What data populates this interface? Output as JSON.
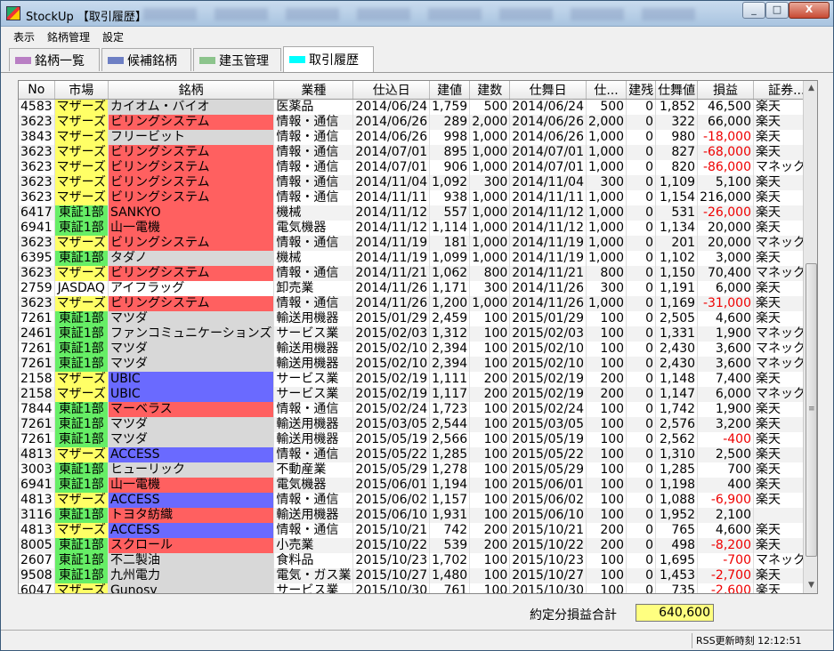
{
  "window": {
    "title": "StockUp 【取引履歴】",
    "min": "_",
    "max": "□",
    "close": "X"
  },
  "menu": [
    "表示",
    "銘柄管理",
    "設定"
  ],
  "tabs": [
    {
      "label": "銘柄一覧",
      "color": "#b97fc4"
    },
    {
      "label": "候補銘柄",
      "color": "#6d7fc4"
    },
    {
      "label": "建玉管理",
      "color": "#8cc48c"
    },
    {
      "label": "取引履歴",
      "color": "#00ffff"
    }
  ],
  "columns": [
    "No",
    "市場",
    "銘柄",
    "業種",
    "仕込日",
    "建値",
    "建数",
    "仕舞日",
    "仕...",
    "建残",
    "仕舞値",
    "損益",
    "証券..."
  ],
  "market_colors": {
    "マザーズ": "#ffff66",
    "東証1部": "#66ee66",
    "JASDAQ": "#ffffff"
  },
  "rows": [
    [
      "4583",
      "マザーズ",
      "カイオム・バイオ",
      "医薬品",
      "2014/06/24",
      "1,759",
      "500",
      "2014/06/24",
      "500",
      "0",
      "1,852",
      "46,500",
      "楽天"
    ],
    [
      "3623",
      "マザーズ",
      "ビリングシステム",
      "情報・通信",
      "2014/06/26",
      "289",
      "2,000",
      "2014/06/26",
      "2,000",
      "0",
      "322",
      "66,000",
      "楽天"
    ],
    [
      "3843",
      "マザーズ",
      "フリービット",
      "情報・通信",
      "2014/06/26",
      "998",
      "1,000",
      "2014/06/26",
      "1,000",
      "0",
      "980",
      "-18,000",
      "楽天"
    ],
    [
      "3623",
      "マザーズ",
      "ビリングシステム",
      "情報・通信",
      "2014/07/01",
      "895",
      "1,000",
      "2014/07/01",
      "1,000",
      "0",
      "827",
      "-68,000",
      "楽天"
    ],
    [
      "3623",
      "マザーズ",
      "ビリングシステム",
      "情報・通信",
      "2014/07/01",
      "906",
      "1,000",
      "2014/07/01",
      "1,000",
      "0",
      "820",
      "-86,000",
      "マネックス"
    ],
    [
      "3623",
      "マザーズ",
      "ビリングシステム",
      "情報・通信",
      "2014/11/04",
      "1,092",
      "300",
      "2014/11/04",
      "300",
      "0",
      "1,109",
      "5,100",
      "楽天"
    ],
    [
      "3623",
      "マザーズ",
      "ビリングシステム",
      "情報・通信",
      "2014/11/11",
      "938",
      "1,000",
      "2014/11/11",
      "1,000",
      "0",
      "1,154",
      "216,000",
      "楽天"
    ],
    [
      "6417",
      "東証1部",
      "SANKYO",
      "機械",
      "2014/11/12",
      "557",
      "1,000",
      "2014/11/12",
      "1,000",
      "0",
      "531",
      "-26,000",
      "楽天"
    ],
    [
      "6941",
      "東証1部",
      "山一電機",
      "電気機器",
      "2014/11/12",
      "1,114",
      "1,000",
      "2014/11/12",
      "1,000",
      "0",
      "1,134",
      "20,000",
      "楽天"
    ],
    [
      "3623",
      "マザーズ",
      "ビリングシステム",
      "情報・通信",
      "2014/11/19",
      "181",
      "1,000",
      "2014/11/19",
      "1,000",
      "0",
      "201",
      "20,000",
      "マネックス"
    ],
    [
      "6395",
      "東証1部",
      "タダノ",
      "機械",
      "2014/11/19",
      "1,099",
      "1,000",
      "2014/11/19",
      "1,000",
      "0",
      "1,102",
      "3,000",
      "楽天"
    ],
    [
      "3623",
      "マザーズ",
      "ビリングシステム",
      "情報・通信",
      "2014/11/21",
      "1,062",
      "800",
      "2014/11/21",
      "800",
      "0",
      "1,150",
      "70,400",
      "マネックス"
    ],
    [
      "2759",
      "JASDAQ",
      "アイフラッグ",
      "卸売業",
      "2014/11/26",
      "1,171",
      "300",
      "2014/11/26",
      "300",
      "0",
      "1,191",
      "6,000",
      "楽天"
    ],
    [
      "3623",
      "マザーズ",
      "ビリングシステム",
      "情報・通信",
      "2014/11/26",
      "1,200",
      "1,000",
      "2014/11/26",
      "1,000",
      "0",
      "1,169",
      "-31,000",
      "楽天"
    ],
    [
      "7261",
      "東証1部",
      "マツダ",
      "輸送用機器",
      "2015/01/29",
      "2,459",
      "100",
      "2015/01/29",
      "100",
      "0",
      "2,505",
      "4,600",
      "楽天"
    ],
    [
      "2461",
      "東証1部",
      "ファンコミュニケーションズ",
      "サービス業",
      "2015/02/03",
      "1,312",
      "100",
      "2015/02/03",
      "100",
      "0",
      "1,331",
      "1,900",
      "マネックス"
    ],
    [
      "7261",
      "東証1部",
      "マツダ",
      "輸送用機器",
      "2015/02/10",
      "2,394",
      "100",
      "2015/02/10",
      "100",
      "0",
      "2,430",
      "3,600",
      "マネックス"
    ],
    [
      "7261",
      "東証1部",
      "マツダ",
      "輸送用機器",
      "2015/02/10",
      "2,394",
      "100",
      "2015/02/10",
      "100",
      "0",
      "2,430",
      "3,600",
      "マネックス"
    ],
    [
      "2158",
      "マザーズ",
      "UBIC",
      "サービス業",
      "2015/02/19",
      "1,111",
      "200",
      "2015/02/19",
      "200",
      "0",
      "1,148",
      "7,400",
      "楽天"
    ],
    [
      "2158",
      "マザーズ",
      "UBIC",
      "サービス業",
      "2015/02/19",
      "1,117",
      "200",
      "2015/02/19",
      "200",
      "0",
      "1,147",
      "6,000",
      "マネックス"
    ],
    [
      "7844",
      "東証1部",
      "マーベラス",
      "情報・通信",
      "2015/02/24",
      "1,723",
      "100",
      "2015/02/24",
      "100",
      "0",
      "1,742",
      "1,900",
      "楽天"
    ],
    [
      "7261",
      "東証1部",
      "マツダ",
      "輸送用機器",
      "2015/03/05",
      "2,544",
      "100",
      "2015/03/05",
      "100",
      "0",
      "2,576",
      "3,200",
      "楽天"
    ],
    [
      "7261",
      "東証1部",
      "マツダ",
      "輸送用機器",
      "2015/05/19",
      "2,566",
      "100",
      "2015/05/19",
      "100",
      "0",
      "2,562",
      "-400",
      "楽天"
    ],
    [
      "4813",
      "マザーズ",
      "ACCESS",
      "情報・通信",
      "2015/05/22",
      "1,285",
      "100",
      "2015/05/22",
      "100",
      "0",
      "1,310",
      "2,500",
      "楽天"
    ],
    [
      "3003",
      "東証1部",
      "ヒューリック",
      "不動産業",
      "2015/05/29",
      "1,278",
      "100",
      "2015/05/29",
      "100",
      "0",
      "1,285",
      "700",
      "楽天"
    ],
    [
      "6941",
      "東証1部",
      "山一電機",
      "電気機器",
      "2015/06/01",
      "1,194",
      "100",
      "2015/06/01",
      "100",
      "0",
      "1,198",
      "400",
      "楽天"
    ],
    [
      "4813",
      "マザーズ",
      "ACCESS",
      "情報・通信",
      "2015/06/02",
      "1,157",
      "100",
      "2015/06/02",
      "100",
      "0",
      "1,088",
      "-6,900",
      "楽天"
    ],
    [
      "3116",
      "東証1部",
      "トヨタ紡織",
      "輸送用機器",
      "2015/06/10",
      "1,931",
      "100",
      "2015/06/10",
      "100",
      "0",
      "1,952",
      "2,100",
      ""
    ],
    [
      "4813",
      "マザーズ",
      "ACCESS",
      "情報・通信",
      "2015/10/21",
      "742",
      "200",
      "2015/10/21",
      "200",
      "0",
      "765",
      "4,600",
      "楽天"
    ],
    [
      "8005",
      "東証1部",
      "スクロール",
      "小売業",
      "2015/10/22",
      "539",
      "200",
      "2015/10/22",
      "200",
      "0",
      "498",
      "-8,200",
      "楽天"
    ],
    [
      "2607",
      "東証1部",
      "不二製油",
      "食料品",
      "2015/10/23",
      "1,702",
      "100",
      "2015/10/23",
      "100",
      "0",
      "1,695",
      "-700",
      "マネックス"
    ],
    [
      "9508",
      "東証1部",
      "九州電力",
      "電気・ガス業",
      "2015/10/27",
      "1,480",
      "100",
      "2015/10/27",
      "100",
      "0",
      "1,453",
      "-2,700",
      "楽天"
    ],
    [
      "6047",
      "マザーズ",
      "Gunosy",
      "サービス業",
      "2015/10/30",
      "761",
      "100",
      "2015/10/30",
      "100",
      "0",
      "735",
      "-2,600",
      "楽天"
    ]
  ],
  "name_colors": [
    "#d8d8d8",
    "#ff6060",
    "#d8d8d8",
    "#ff6060",
    "#ff6060",
    "#ff6060",
    "#ff6060",
    "#ff6060",
    "#ff6060",
    "#ff6060",
    "#d8d8d8",
    "#ff6060",
    "#ffffff",
    "#ff6060",
    "#d8d8d8",
    "#d8d8d8",
    "#d8d8d8",
    "#d8d8d8",
    "#6a6aff",
    "#6a6aff",
    "#ff6060",
    "#d8d8d8",
    "#d8d8d8",
    "#6a6aff",
    "#d8d8d8",
    "#ff6060",
    "#6a6aff",
    "#ff6060",
    "#6a6aff",
    "#ff6060",
    "#d8d8d8",
    "#d8d8d8",
    "#d8d8d8"
  ],
  "total": {
    "label": "約定分損益合計",
    "value": "640,600"
  },
  "status": {
    "rss": "RSS更新時刻 12:12:51"
  }
}
